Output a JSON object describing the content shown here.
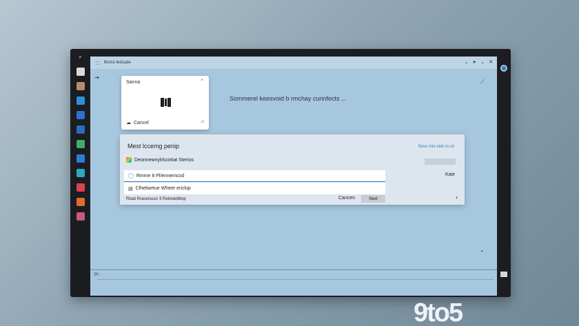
{
  "window": {
    "title": "Mcmo ledcade",
    "controls": [
      "⌄",
      "🐦",
      "⌄",
      "✕"
    ]
  },
  "taskbar": {
    "items": [
      {
        "icon": "search-icon",
        "label": "",
        "color": "#e5e5e5"
      },
      {
        "icon": "file-icon",
        "label": "",
        "color": "#d9d9d9"
      },
      {
        "icon": "store-icon",
        "label": "",
        "color": "#b58b72"
      },
      {
        "icon": "edge-icon",
        "label": "",
        "color": "#2f8fd7"
      },
      {
        "icon": "globe-icon",
        "label": "",
        "color": "#2f6fd0"
      },
      {
        "icon": "mail-icon",
        "label": "",
        "color": "#2a6cc3"
      },
      {
        "icon": "app-icon",
        "label": "",
        "color": "#44aa66"
      },
      {
        "icon": "photos-icon",
        "label": "",
        "color": "#2d7cd6"
      },
      {
        "icon": "chat-icon",
        "label": "",
        "color": "#2fa6c8"
      },
      {
        "icon": "camera-icon",
        "label": "",
        "color": "#d8434f"
      },
      {
        "icon": "game-icon",
        "label": "",
        "color": "#e16b2f"
      },
      {
        "icon": "music-icon",
        "label": "",
        "color": "#c45a7c"
      }
    ]
  },
  "top_card": {
    "title": "Sanna",
    "menu": "⌃",
    "footer_label": "Cancel",
    "footer_icon": "cloud-icon",
    "lock_icon": "lock-icon"
  },
  "heading": "Sommerel keesvoid b rmchay curinfects ...",
  "dialog": {
    "title": "Mest lccemg penip",
    "link": "Seso mlo ned cn cit",
    "sub_row": "Deonnewnyklscirtiat Sterios",
    "field_1": "Rmme 8 Pl/ennemcod",
    "field_2": "Clhetiwrtue Wheer ericlop",
    "side_label": "Kaie",
    "footer": "Rloat  Rracenscor 3 Retoneblitop",
    "cancel": "Cancen",
    "next": "Next",
    "chevron": "›"
  },
  "bottom_hint": "Pr:",
  "watermark": "9to5",
  "colors": {
    "accent": "#2f7bb8",
    "screen_bg": "#a7c7df",
    "dialog_bg": "#dde6ee"
  }
}
